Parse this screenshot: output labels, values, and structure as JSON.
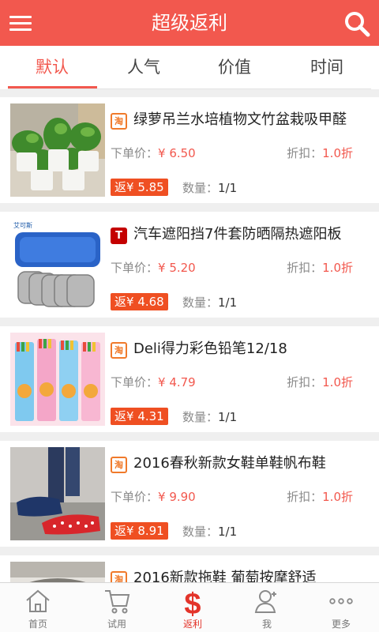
{
  "header": {
    "title": "超级返利"
  },
  "tabs": [
    {
      "label": "默认",
      "active": true
    },
    {
      "label": "人气",
      "active": false
    },
    {
      "label": "价值",
      "active": false
    },
    {
      "label": "时间",
      "active": false
    }
  ],
  "labels": {
    "price": "下单价：",
    "discount": "折扣：",
    "quantity": "数量：",
    "rebate_prefix": "返"
  },
  "items": [
    {
      "source": "tao",
      "source_label": "淘",
      "title": "绿萝吊兰水培植物文竹盆栽吸甲醛",
      "price": "¥ 6.50",
      "discount": "1.0折",
      "rebate": "¥ 5.85",
      "quantity": "1/1"
    },
    {
      "source": "tmall",
      "source_label": "T",
      "title": "汽车遮阳挡7件套防晒隔热遮阳板",
      "price": "¥ 5.20",
      "discount": "1.0折",
      "rebate": "¥ 4.68",
      "quantity": "1/1"
    },
    {
      "source": "tao",
      "source_label": "淘",
      "title": "Deli得力彩色铅笔12/18",
      "price": "¥ 4.79",
      "discount": "1.0折",
      "rebate": "¥ 4.31",
      "quantity": "1/1"
    },
    {
      "source": "tao",
      "source_label": "淘",
      "title": "2016春秋新款女鞋单鞋帆布鞋",
      "price": "¥ 9.90",
      "discount": "1.0折",
      "rebate": "¥ 8.91",
      "quantity": "1/1"
    },
    {
      "source": "tao",
      "source_label": "淘",
      "title": "2016新款拖鞋 葡萄按摩舒适",
      "price": "",
      "discount": "",
      "rebate": "",
      "quantity": ""
    }
  ],
  "nav": [
    {
      "label": "首页",
      "icon": "home-icon",
      "active": false
    },
    {
      "label": "试用",
      "icon": "cart-icon",
      "active": false
    },
    {
      "label": "返利",
      "icon": "dollar-icon",
      "active": true
    },
    {
      "label": "我",
      "icon": "user-icon",
      "active": false
    },
    {
      "label": "更多",
      "icon": "more-icon",
      "active": false
    }
  ],
  "colors": {
    "primary": "#f2584e",
    "rebate": "#ef4f22",
    "taobao": "#f07a2b",
    "tmall": "#c40000"
  }
}
